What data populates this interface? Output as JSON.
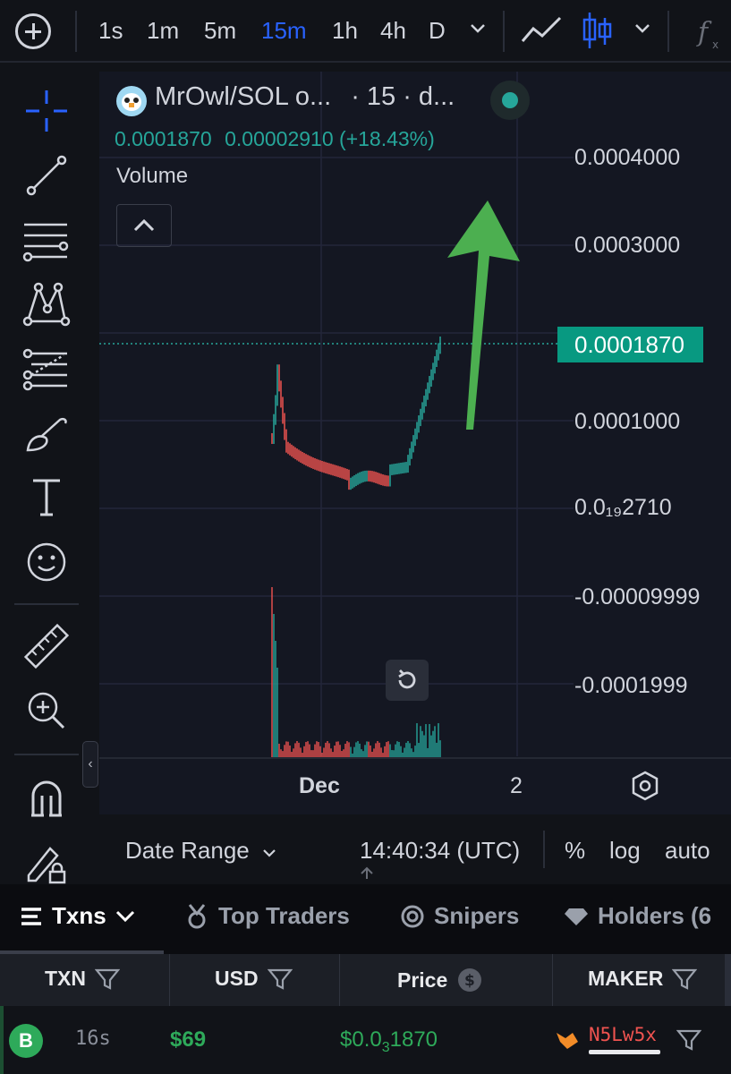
{
  "toolbar": {
    "intervals": [
      "1s",
      "1m",
      "5m",
      "15m",
      "1h",
      "4h",
      "D"
    ],
    "active_interval": "15m",
    "accent_color": "#2962ff"
  },
  "left_tools": [
    "crosshair-icon",
    "trend-line-icon",
    "horizontal-lines-icon",
    "pattern-icon",
    "fib-icon",
    "brush-icon",
    "text-icon",
    "emoji-icon",
    "ruler-icon",
    "zoom-in-icon",
    "magnet-icon",
    "lock-pencil-icon"
  ],
  "legend": {
    "title": "MrOwl/SOL o...",
    "meta": "· 15 · d...",
    "price": "0.0001870",
    "change": "0.00002910 (+18.43%)",
    "volume_label": "Volume"
  },
  "price_axis": {
    "ticks": [
      "0.0004000",
      "0.0003000",
      "0.0001000",
      "0.0₁₉2710",
      "-0.00009999",
      "-0.0001999"
    ],
    "current_price": "0.0001870",
    "current_color": "#089981"
  },
  "time_axis": {
    "labels": [
      "Dec",
      "2"
    ]
  },
  "bottom_bar": {
    "date_range": "Date Range",
    "clock": "14:40:34 (UTC)",
    "percent": "%",
    "log": "log",
    "auto": "auto"
  },
  "tabs": [
    {
      "label": "Txns",
      "active": true
    },
    {
      "label": "Top Traders",
      "active": false
    },
    {
      "label": "Snipers",
      "active": false
    },
    {
      "label": "Holders (6",
      "active": false
    }
  ],
  "table": {
    "columns": [
      "TXN",
      "USD",
      "Price",
      "MAKER"
    ],
    "rows": [
      {
        "type": "B",
        "age": "16s",
        "usd": "$69",
        "price_prefix": "$0.0",
        "price_sub": "3",
        "price_rest": "1870",
        "maker": "N5Lw5x"
      }
    ]
  },
  "colors": {
    "up": "#26a69a",
    "down": "#ef5350",
    "arrow": "#4caf50",
    "buy_green": "#2eaa5a"
  }
}
